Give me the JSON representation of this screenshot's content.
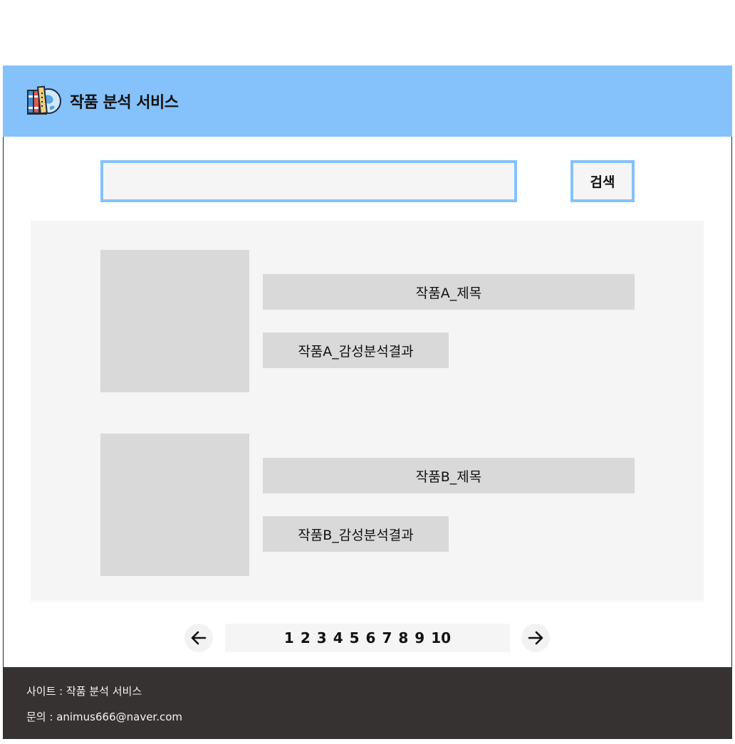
{
  "header": {
    "title": "작품 분석 서비스",
    "logo_icon": "books-globe-logo-icon"
  },
  "search": {
    "value": "",
    "placeholder": "",
    "button_label": "검색"
  },
  "results": [
    {
      "title": "작품A_제목",
      "sentiment": "작품A_감성분석결과"
    },
    {
      "title": "작품B_제목",
      "sentiment": "작품B_감성분석결과"
    }
  ],
  "pagination": {
    "prev_icon": "arrow-left-icon",
    "next_icon": "arrow-right-icon",
    "pages": [
      "1",
      "2",
      "3",
      "4",
      "5",
      "6",
      "7",
      "8",
      "9",
      "10"
    ]
  },
  "footer": {
    "site": "사이트 : 작품 분석 서비스",
    "contact": "문의 : animus666@naver.com"
  },
  "colors": {
    "accent": "#85c1fa",
    "panel": "#f5f5f5",
    "placeholder_box": "#d9d9d9",
    "footer_bg": "#363232"
  }
}
